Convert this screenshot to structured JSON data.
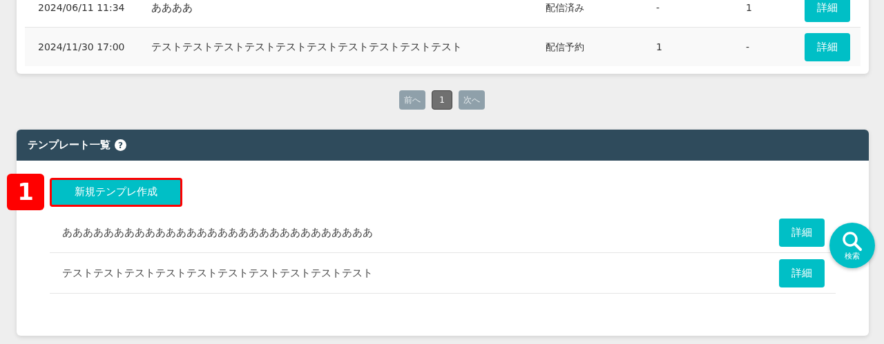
{
  "deliveries": {
    "rows": [
      {
        "date": "2024/06/11 11:34",
        "title": "ああああ",
        "status": "配信済み",
        "column_4": "-",
        "column_5": "1",
        "action": "詳細"
      },
      {
        "date": "2024/11/30 17:00",
        "title": "テストテストテストテストテストテストテストテストテストテスト",
        "status": "配信予約",
        "column_4": "1",
        "column_5": "-",
        "action": "詳細"
      }
    ]
  },
  "pagination": [
    {
      "label": "前へ",
      "selected": false,
      "disabled": true
    },
    {
      "label": "1",
      "selected": true,
      "disabled": false
    },
    {
      "label": "次へ",
      "selected": false,
      "disabled": true
    }
  ],
  "templates": {
    "title": "テンプレート一覧",
    "help": "?",
    "annotation": "1",
    "new_button": "新規テンプレ作成",
    "items": [
      {
        "name": "ああああああああああああああああああああああああああああああ",
        "action": "詳細"
      },
      {
        "name": "テストテストテストテストテストテストテストテストテストテスト",
        "action": "詳細"
      }
    ]
  },
  "search_button": {
    "label": "検索"
  }
}
